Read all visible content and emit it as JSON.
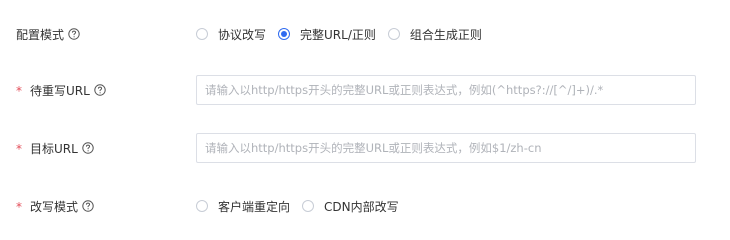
{
  "config_mode": {
    "label": "配置模式",
    "options": [
      {
        "label": "协议改写",
        "checked": false
      },
      {
        "label": "完整URL/正则",
        "checked": true
      },
      {
        "label": "组合生成正则",
        "checked": false
      }
    ]
  },
  "rewrite_url": {
    "label": "待重写URL",
    "required": "*",
    "value": "",
    "placeholder": "请输入以http/https开头的完整URL或正则表达式，例如(^https?://[^/]+)/.*"
  },
  "target_url": {
    "label": "目标URL",
    "required": "*",
    "value": "",
    "placeholder": "请输入以http/https开头的完整URL或正则表达式，例如$1/zh-cn"
  },
  "rewrite_mode": {
    "label": "改写模式",
    "required": "*",
    "options": [
      {
        "label": "客户端重定向",
        "checked": false
      },
      {
        "label": "CDN内部改写",
        "checked": false
      }
    ]
  },
  "colors": {
    "accent": "#2f6bf0",
    "required": "#e34d59",
    "border": "#dcdfe6",
    "placeholder": "#b0b3b9",
    "text": "#333333"
  },
  "icons": {
    "help": "question-circle-icon"
  }
}
